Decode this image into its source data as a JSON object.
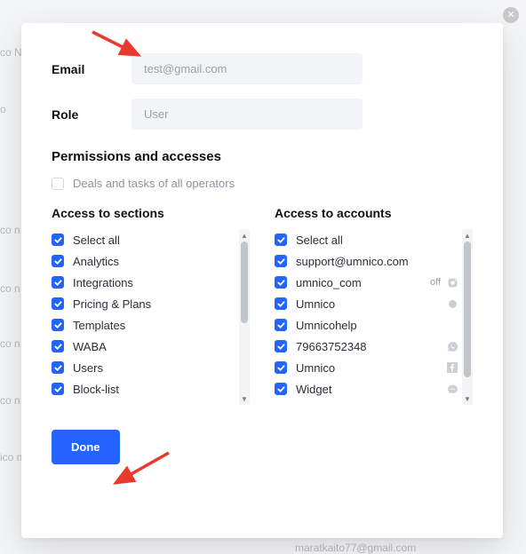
{
  "bg": {
    "t1": "co N",
    "t2": "co n",
    "t3": "co n",
    "t4": "co n",
    "t5": "co n",
    "t6": "ico n",
    "t7": "o",
    "footer_email": "maratkaito77@gmail.com"
  },
  "close_icon": "✕",
  "form": {
    "email_label": "Email",
    "email_value": "test@gmail.com",
    "role_label": "Role",
    "role_value": "User"
  },
  "permissions": {
    "title": "Permissions and accesses",
    "deals_label": "Deals and tasks of all operators",
    "deals_checked": false
  },
  "sections": {
    "title": "Access to sections",
    "items": [
      {
        "label": "Select all",
        "checked": true
      },
      {
        "label": "Analytics",
        "checked": true
      },
      {
        "label": "Integrations",
        "checked": true
      },
      {
        "label": "Pricing & Plans",
        "checked": true
      },
      {
        "label": "Templates",
        "checked": true
      },
      {
        "label": "WABA",
        "checked": true
      },
      {
        "label": "Users",
        "checked": true
      },
      {
        "label": "Block-list",
        "checked": true
      }
    ]
  },
  "accounts": {
    "title": "Access to accounts",
    "items": [
      {
        "label": "Select all",
        "checked": true,
        "icon": null
      },
      {
        "label": "support@umnico.com",
        "checked": true,
        "icon": null
      },
      {
        "label": "umnico_com",
        "ext": "off",
        "checked": true,
        "icon": "instagram"
      },
      {
        "label": "Umnico",
        "checked": true,
        "icon": "dot"
      },
      {
        "label": "Umnicohelp",
        "checked": true,
        "icon": null
      },
      {
        "label": "79663752348",
        "checked": true,
        "icon": "whatsapp"
      },
      {
        "label": "Umnico",
        "checked": true,
        "icon": "facebook"
      },
      {
        "label": "Widget",
        "checked": true,
        "icon": "chat"
      }
    ]
  },
  "done_label": "Done",
  "colors": {
    "accent": "#2563ff",
    "arrow": "#e63a2e"
  }
}
